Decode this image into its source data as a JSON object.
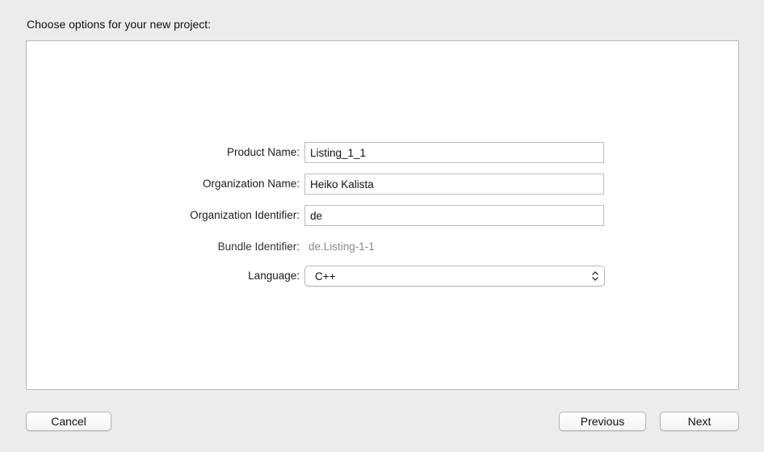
{
  "dialog": {
    "heading": "Choose options for your new project:"
  },
  "form": {
    "product_name": {
      "label": "Product Name:",
      "value": "Listing_1_1"
    },
    "organization_name": {
      "label": "Organization Name:",
      "value": "Heiko Kalista"
    },
    "organization_identifier": {
      "label": "Organization Identifier:",
      "value": "de"
    },
    "bundle_identifier": {
      "label": "Bundle Identifier:",
      "value": "de.Listing-1-1"
    },
    "language": {
      "label": "Language:",
      "selected": "C++",
      "icon": "up-down-chevron-icon"
    }
  },
  "buttons": {
    "cancel": "Cancel",
    "previous": "Previous",
    "next": "Next"
  }
}
